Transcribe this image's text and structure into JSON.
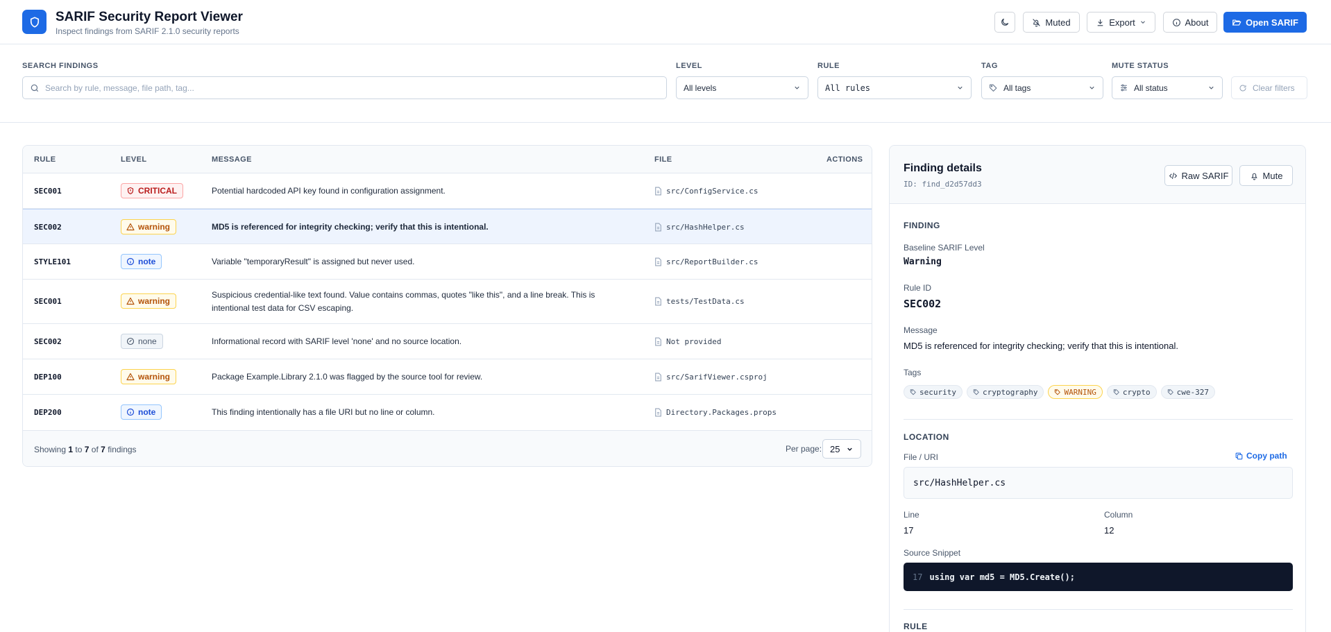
{
  "header": {
    "title": "SARIF Security Report Viewer",
    "subtitle": "Inspect findings from SARIF 2.1.0 security reports",
    "logo_icon": "shield-icon",
    "buttons": {
      "theme_icon": "moon-icon",
      "muted": "Muted",
      "export": "Export",
      "about": "About",
      "open_sarif": "Open SARIF"
    },
    "accent": "#1d6ae5"
  },
  "filters": {
    "search": {
      "label": "SEARCH FINDINGS",
      "placeholder": "Search by rule, message, file path, tag..."
    },
    "level": {
      "label": "LEVEL",
      "value": "All levels"
    },
    "rule": {
      "label": "RULE",
      "value": "All rules"
    },
    "tag": {
      "label": "TAG",
      "value": "All tags"
    },
    "mute": {
      "label": "MUTE STATUS",
      "value": "All status"
    },
    "clear": "Clear filters"
  },
  "table": {
    "columns": {
      "rule": "RULE",
      "level": "LEVEL",
      "message": "MESSAGE",
      "file": "FILE",
      "actions": "ACTIONS"
    },
    "rows": [
      {
        "rule": "SEC001",
        "level": "CRITICAL",
        "message": "Potential hardcoded API key found in configuration assignment.",
        "file": "src/ConfigService.cs"
      },
      {
        "rule": "SEC002",
        "level": "warning",
        "message": "MD5 is referenced for integrity checking; verify that this is intentional.",
        "file": "src/HashHelper.cs"
      },
      {
        "rule": "STYLE101",
        "level": "note",
        "message": "Variable \"temporaryResult\" is assigned but never used.",
        "file": "src/ReportBuilder.cs"
      },
      {
        "rule": "SEC001",
        "level": "warning",
        "message": "Suspicious credential-like text found. Value contains commas, quotes \"like this\", and a line break. This is intentional test data for CSV escaping.",
        "file": "tests/TestData.cs"
      },
      {
        "rule": "SEC002",
        "level": "none",
        "message": "Informational record with SARIF level 'none' and no source location.",
        "file": "Not provided"
      },
      {
        "rule": "DEP100",
        "level": "warning",
        "message": "Package Example.Library 2.1.0 was flagged by the source tool for review.",
        "file": "src/SarifViewer.csproj"
      },
      {
        "rule": "DEP200",
        "level": "note",
        "message": "This finding intentionally has a file URI but no line or column.",
        "file": "Directory.Packages.props"
      }
    ],
    "footer": {
      "showing_prefix": "Showing",
      "from": "1",
      "to_word": "to",
      "to": "7",
      "of_word": "of",
      "total": "7",
      "suffix": "findings",
      "per_page_label": "Per page:",
      "per_page_value": "25"
    }
  },
  "details": {
    "title": "Finding details",
    "id": "ID: find_d2d57dd3",
    "raw_sarif": "Raw SARIF",
    "mute": "Mute",
    "finding_section": "FINDING",
    "baseline_label": "Baseline SARIF Level",
    "baseline_value": "Warning",
    "rule_id_label": "Rule ID",
    "rule_id_value": "SEC002",
    "message_label": "Message",
    "message_value": "MD5 is referenced for integrity checking; verify that this is intentional.",
    "tags_label": "Tags",
    "tags": [
      "security",
      "cryptography",
      "WARNING",
      "crypto",
      "cwe-327"
    ],
    "location_section": "LOCATION",
    "file_label": "File / URI",
    "copy_path": "Copy path",
    "file_value": "src/HashHelper.cs",
    "line_label": "Line",
    "line_value": "17",
    "column_label": "Column",
    "column_value": "12",
    "snippet_label": "Source Snippet",
    "snippet_line": "17",
    "snippet_code": "using var md5 = MD5.Create();",
    "rule_section": "RULE"
  }
}
